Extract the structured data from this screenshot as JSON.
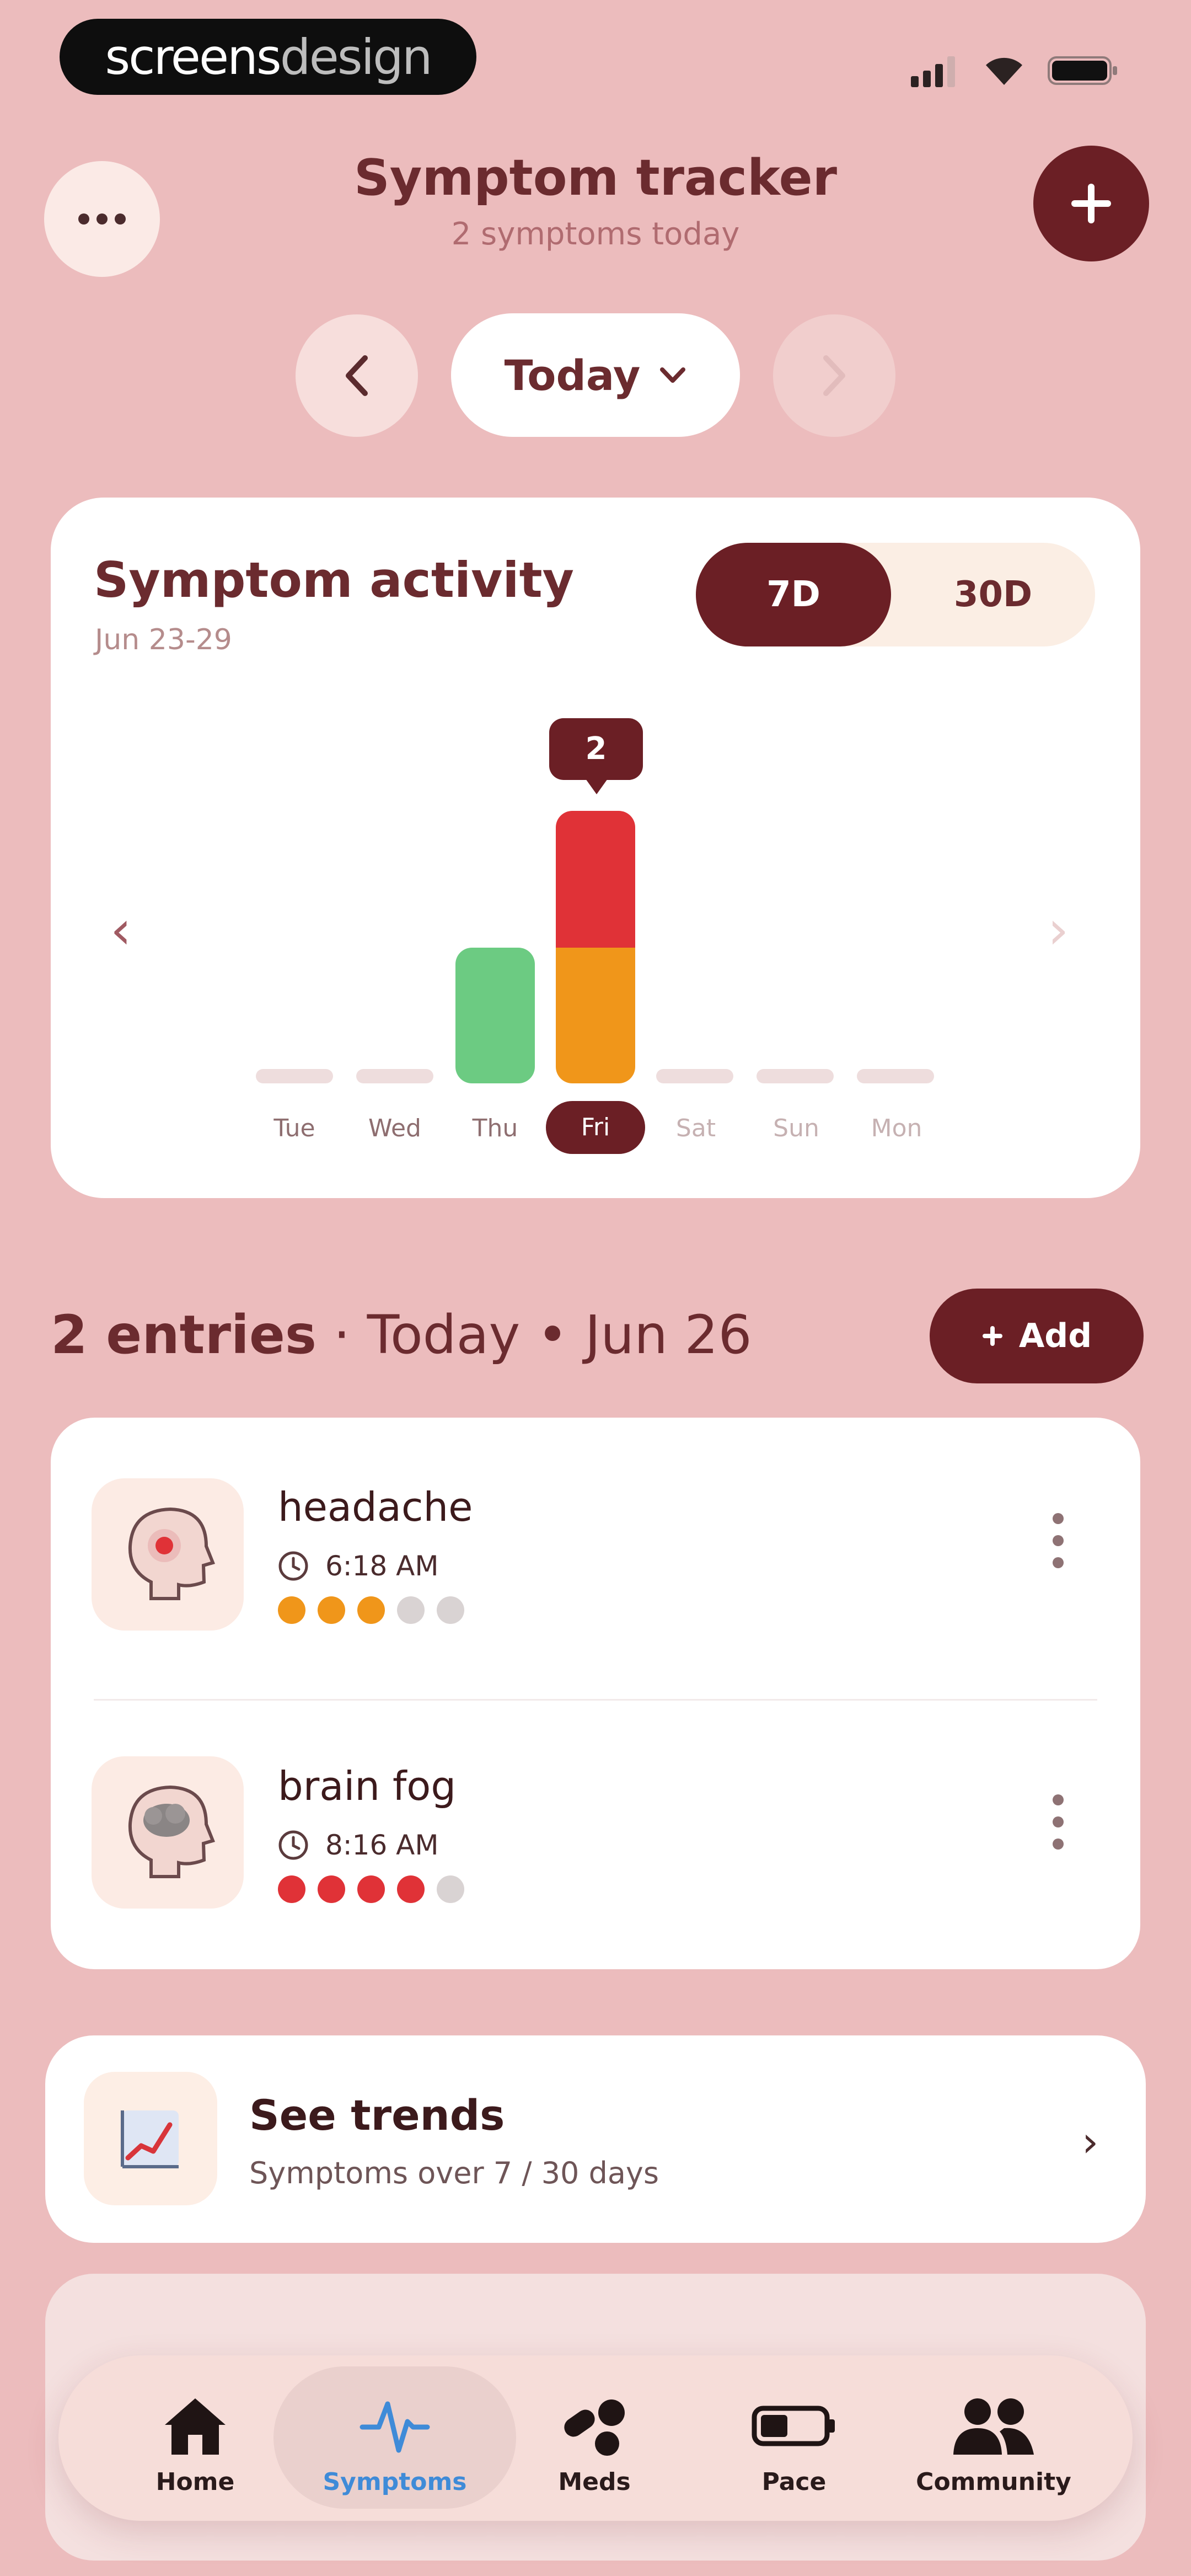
{
  "status_bar": {
    "brand_left": "screens",
    "brand_right": "design",
    "icons": [
      "signal-icon",
      "wifi-icon",
      "battery-icon"
    ]
  },
  "header": {
    "title": "Symptom tracker",
    "subtitle": "2 symptoms today",
    "menu_icon": "more-horizontal-icon",
    "add_icon": "plus-icon"
  },
  "date_selector": {
    "label": "Today",
    "prev_icon": "chevron-left-icon",
    "next_icon": "chevron-right-icon"
  },
  "activity": {
    "title": "Symptom activity",
    "range": "Jun 23-29",
    "segments": [
      "7D",
      "30D"
    ],
    "selected_segment": "7D",
    "tooltip_value": "2",
    "days": [
      "Tue",
      "Wed",
      "Thu",
      "Fri",
      "Sat",
      "Sun",
      "Mon"
    ],
    "selected_day": "Fri",
    "bars": [
      {
        "day": "Thu",
        "stack": [
          {
            "color": "#6ccb82",
            "value": 1
          }
        ]
      },
      {
        "day": "Fri",
        "stack": [
          {
            "color": "#f0961a",
            "value": 1
          },
          {
            "color": "#e03237",
            "value": 1
          }
        ]
      }
    ],
    "colors": {
      "green": "#6ccb82",
      "orange": "#f0961a",
      "red": "#e03237"
    }
  },
  "entries": {
    "count_label": "2 entries",
    "date_label": "Today • Jun 26",
    "add_label": "Add",
    "items": [
      {
        "name": "headache",
        "time": "6:18 AM",
        "severity": 3,
        "max": 5,
        "color": "#f0961a",
        "icon": "headache-head-icon"
      },
      {
        "name": "brain fog",
        "time": "8:16 AM",
        "severity": 4,
        "max": 5,
        "color": "#e03237",
        "icon": "brain-fog-head-icon"
      }
    ]
  },
  "trends": {
    "title": "See trends",
    "subtitle": "Symptoms over 7 / 30 days",
    "icon": "trend-chart-icon"
  },
  "tabbar": {
    "active": "Symptoms",
    "tabs": [
      {
        "label": "Home",
        "icon": "home-icon"
      },
      {
        "label": "Symptoms",
        "icon": "pulse-icon"
      },
      {
        "label": "Meds",
        "icon": "pills-icon"
      },
      {
        "label": "Pace",
        "icon": "battery-pace-icon"
      },
      {
        "label": "Community",
        "icon": "people-icon"
      }
    ]
  }
}
